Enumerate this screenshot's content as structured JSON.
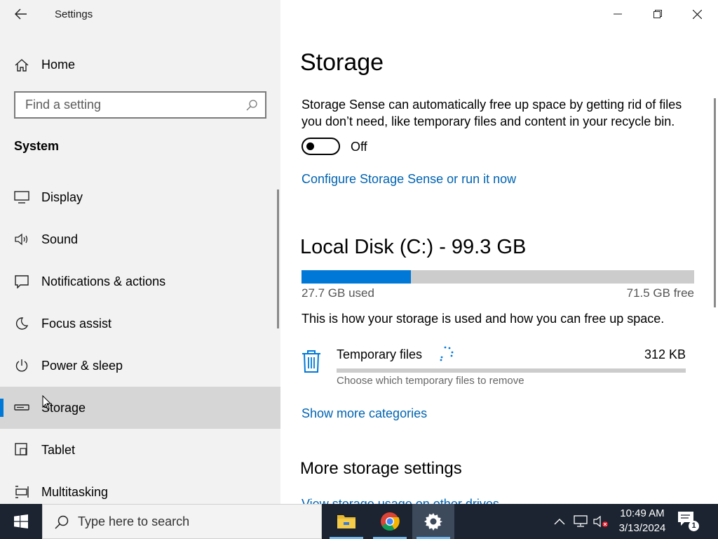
{
  "window": {
    "app_title": "Settings",
    "controls": [
      "minimize-icon",
      "restore-icon",
      "close-icon"
    ]
  },
  "sidebar": {
    "home_label": "Home",
    "search_placeholder": "Find a setting",
    "section_heading": "System",
    "items": [
      {
        "label": "Display",
        "icon": "display-icon"
      },
      {
        "label": "Sound",
        "icon": "speaker-icon"
      },
      {
        "label": "Notifications & actions",
        "icon": "notification-icon"
      },
      {
        "label": "Focus assist",
        "icon": "moon-icon"
      },
      {
        "label": "Power & sleep",
        "icon": "power-icon"
      },
      {
        "label": "Storage",
        "icon": "drive-icon",
        "selected": true
      },
      {
        "label": "Tablet",
        "icon": "tablet-icon"
      },
      {
        "label": "Multitasking",
        "icon": "multitasking-icon"
      }
    ]
  },
  "main": {
    "title": "Storage",
    "description": "Storage Sense can automatically free up space by getting rid of files you don’t need, like temporary files and content in your recycle bin.",
    "storage_sense_state": "Off",
    "configure_link": "Configure Storage Sense or run it now",
    "disk": {
      "title": "Local Disk (C:) - 99.3 GB",
      "used_label": "27.7 GB used",
      "free_label": "71.5 GB free",
      "used_fraction": 0.279
    },
    "usage_description": "This is how your storage is used and how you can free up space.",
    "categories": [
      {
        "name": "Temporary files",
        "size": "312 KB",
        "subtitle": "Choose which temporary files to remove",
        "fill_fraction": 0.0
      }
    ],
    "show_more_link": "Show more categories",
    "more_settings_title": "More storage settings",
    "cut_off_link": "View storage usage on other drives"
  },
  "taskbar": {
    "search_placeholder": "Type here to search",
    "apps": [
      "file-explorer-icon",
      "chrome-icon",
      "settings-icon"
    ],
    "clock_time": "10:49 AM",
    "clock_date": "3/13/2024",
    "notification_count": "1"
  },
  "colors": {
    "accent": "#0078d7",
    "link": "#0063b1",
    "sidebar_bg": "#f2f2f2",
    "taskbar_bg": "#1b2430"
  }
}
